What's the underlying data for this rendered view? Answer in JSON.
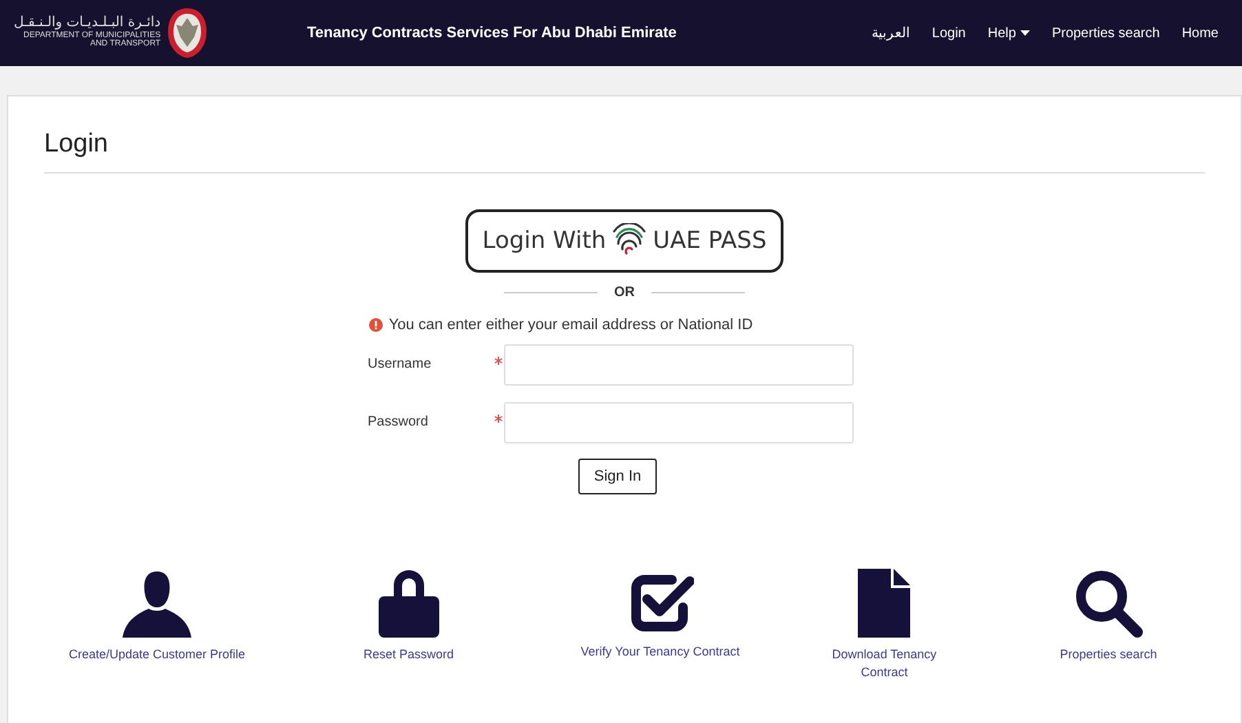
{
  "header": {
    "logo_arabic": "دائـرة البـلـديـات والـنـقـل",
    "logo_line_1": "DEPARTMENT OF MUNICIPALITIES",
    "logo_line_2": "AND TRANSPORT",
    "title": "Tenancy Contracts Services For Abu Dhabi Emirate",
    "nav": [
      {
        "label": "العربية",
        "kind": "link"
      },
      {
        "label": "Login",
        "kind": "link"
      },
      {
        "label": "Help",
        "kind": "dropdown"
      },
      {
        "label": "Properties search",
        "kind": "link"
      },
      {
        "label": "Home",
        "kind": "link"
      }
    ]
  },
  "login": {
    "heading": "Login",
    "uae_pass": {
      "prefix": "Login With",
      "suffix": "UAE PASS"
    },
    "or": "OR",
    "info": "You can enter either your email address or National ID",
    "fields": [
      {
        "label": "Username",
        "required": true
      },
      {
        "label": "Password",
        "required": true
      }
    ],
    "submit": "Sign In"
  },
  "shortcuts": [
    {
      "label": "Create/Update Customer Profile",
      "kind": "user"
    },
    {
      "label": "Reset Password",
      "kind": "lock"
    },
    {
      "label": "Verify Your Tenancy Contract",
      "kind": "check"
    },
    {
      "label": "Download Tenancy Contract",
      "kind": "file"
    },
    {
      "label": "Properties search",
      "kind": "search"
    }
  ]
}
